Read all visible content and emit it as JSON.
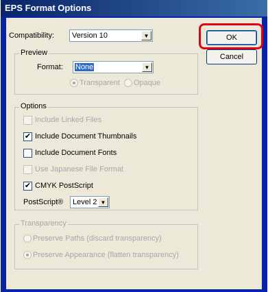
{
  "title": "EPS Format Options",
  "compatibility": {
    "label": "Compatibility:",
    "label_hotkey": "b",
    "label_pre": "Compati",
    "label_post": "ility:",
    "value": "Version 10"
  },
  "preview": {
    "legend": "Preview",
    "format_label": "Format:",
    "format_value": "None",
    "transparent": "Transparent",
    "opaque": "Opaque"
  },
  "options": {
    "legend": "Options",
    "include_linked": "Include Linked Files",
    "include_thumbnails": "Include Document Thumbnails",
    "include_fonts": "Include Document Fonts",
    "japanese": "Use Japanese File Format",
    "cmyk": "CMYK PostScript",
    "postscript_label": "PostScript®",
    "postscript_value": "Level 2"
  },
  "transparency": {
    "legend": "Transparency",
    "preserve_paths": "Preserve Paths (discard transparency)",
    "preserve_appearance": "Preserve Appearance (flatten transparency)"
  },
  "buttons": {
    "ok": "OK",
    "cancel": "Cancel"
  },
  "colors": {
    "title_bar": "#0a246a",
    "dialog_bg": "#ece9d8",
    "highlight": "#e0001a"
  },
  "icons": {
    "dropdown": "chevron-down-icon",
    "checked": "checkmark-icon"
  }
}
